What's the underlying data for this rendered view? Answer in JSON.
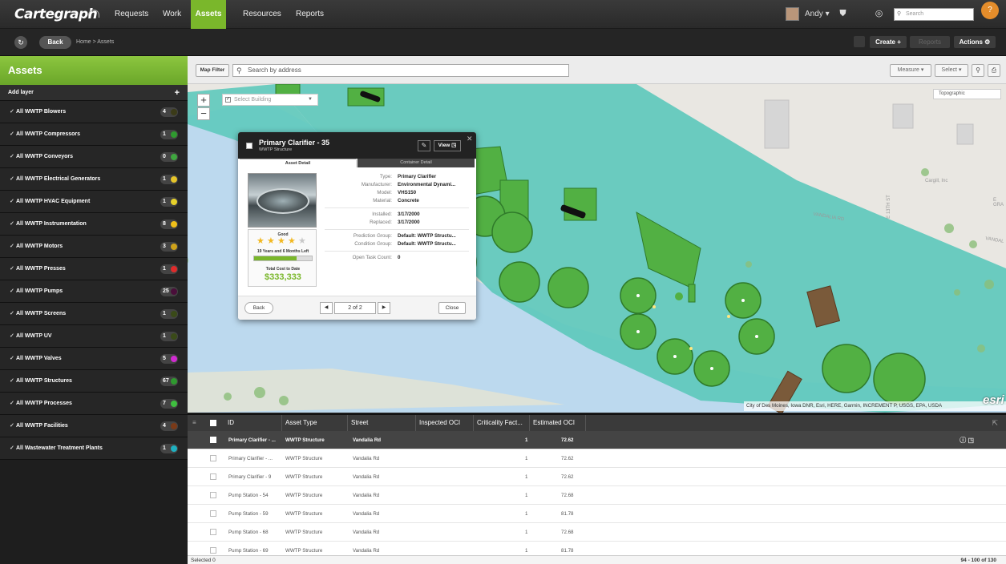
{
  "topnav": {
    "logo": "Cartegraph",
    "links": {
      "requests": "Requests",
      "work": "Work",
      "assets": "Assets",
      "resources": "Resources",
      "reports": "Reports"
    },
    "user": "Andy",
    "search_placeholder": "Search",
    "help_glyph": "?"
  },
  "subbar": {
    "back": "Back",
    "breadcrumb": "Home  >  Assets",
    "create": "Create +",
    "reports": "Reports",
    "actions": "Actions ⚙"
  },
  "sidebar": {
    "title": "Assets",
    "add_layer": "Add layer",
    "layers": [
      {
        "label": "All WWTP Blowers",
        "count": "4",
        "color": "#3b3b18"
      },
      {
        "label": "All WWTP Compressors",
        "count": "1",
        "color": "#2f9a2f"
      },
      {
        "label": "All WWTP Conveyors",
        "count": "0",
        "color": "#3fa63f"
      },
      {
        "label": "All WWTP Electrical Generators",
        "count": "1",
        "color": "#e6c52a"
      },
      {
        "label": "All WWTP HVAC Equipment",
        "count": "1",
        "color": "#e6d12a"
      },
      {
        "label": "All WWTP Instrumentation",
        "count": "8",
        "color": "#f0c019"
      },
      {
        "label": "All WWTP Motors",
        "count": "3",
        "color": "#cfa21a"
      },
      {
        "label": "All WWTP Presses",
        "count": "1",
        "color": "#e02b2b"
      },
      {
        "label": "All WWTP Pumps",
        "count": "25",
        "color": "#4a0e3a"
      },
      {
        "label": "All WWTP Screens",
        "count": "1",
        "color": "#3a4a18"
      },
      {
        "label": "All WWTP UV",
        "count": "1",
        "color": "#3a4a18"
      },
      {
        "label": "All WWTP Valves",
        "count": "5",
        "color": "#d02bd0"
      },
      {
        "label": "All WWTP Structures",
        "count": "67",
        "color": "#2f9a2f"
      },
      {
        "label": "All WWTP Processes",
        "count": "7",
        "color": "#3fbf3f"
      },
      {
        "label": "All WWTP Facilities",
        "count": "4",
        "color": "#7a3a18"
      },
      {
        "label": "All Wastewater Treatment Plants",
        "count": "1",
        "color": "#1fb0c0"
      }
    ]
  },
  "mapbar": {
    "map_filter": "Map Filter",
    "search_placeholder": "Search by address",
    "measure": "Measure",
    "select": "Select"
  },
  "map": {
    "building_select": "Select Building",
    "basemap": "Topographic",
    "attribution": "City of Des Moines, Iowa DNR, Esri, HERE, Garmin, INCREMENT P, USGS, EPA, USDA",
    "esri": "esri",
    "streets": {
      "vandalia": "VANDALIA RD",
      "e13": "E 13TH ST",
      "cargill": "Cargill, Inc",
      "egrand": "E GRA",
      "vandal2": "VANDAL"
    }
  },
  "popup": {
    "title": "Primary Clarifier - 35",
    "subtitle": "WWTP Structure",
    "view": "View",
    "tab_asset": "Asset Detail",
    "tab_container": "Container Detail",
    "condition": "Good",
    "stars": 4,
    "stars_max": 5,
    "life_left": "19 Years and 6 Months Left",
    "life_fraction": 0.74,
    "cost_label": "Total Cost to Date",
    "cost": "$333,333",
    "fields": {
      "type_l": "Type:",
      "type_v": "Primary Clarifier",
      "manufacturer_l": "Manufacturer:",
      "manufacturer_v": "Environmental Dynami...",
      "model_l": "Model:",
      "model_v": "VHS150",
      "material_l": "Material:",
      "material_v": "Concrete",
      "installed_l": "Installed:",
      "installed_v": "3/17/2000",
      "replaced_l": "Replaced:",
      "replaced_v": "3/17/2000",
      "pred_l": "Prediction Group:",
      "pred_v": "Default: WWTP Structu...",
      "cond_l": "Condition Group:",
      "cond_v": "Default: WWTP Structu...",
      "task_l": "Open Task Count:",
      "task_v": "0"
    },
    "back": "Back",
    "page": "2 of 2",
    "close": "Close"
  },
  "grid": {
    "columns": {
      "id": "ID",
      "type": "Asset Type",
      "street": "Street",
      "inspected": "Inspected OCI",
      "criticality": "Criticality Fact...",
      "estimated": "Estimated OCI"
    },
    "rows": [
      {
        "id": "Primary Clarifier - ...",
        "type": "WWTP Structure",
        "street": "Vandalia Rd",
        "crit": "1",
        "oci": "72.62"
      },
      {
        "id": "Primary Clarifier - ...",
        "type": "WWTP Structure",
        "street": "Vandalia Rd",
        "crit": "1",
        "oci": "72.62"
      },
      {
        "id": "Primary Clarifier - 9",
        "type": "WWTP Structure",
        "street": "Vandalia Rd",
        "crit": "1",
        "oci": "72.62"
      },
      {
        "id": "Pump Station - 54",
        "type": "WWTP Structure",
        "street": "Vandalia Rd",
        "crit": "1",
        "oci": "72.68"
      },
      {
        "id": "Pump Station - 59",
        "type": "WWTP Structure",
        "street": "Vandalia Rd",
        "crit": "1",
        "oci": "81.78"
      },
      {
        "id": "Pump Station - 68",
        "type": "WWTP Structure",
        "street": "Vandalia Rd",
        "crit": "1",
        "oci": "72.68"
      },
      {
        "id": "Pump Station - 69",
        "type": "WWTP Structure",
        "street": "Vandalia Rd",
        "crit": "1",
        "oci": "81.78"
      }
    ],
    "selected_label": "Selected 0",
    "range": "94 - 100 of 130"
  },
  "colors": {
    "accent": "#7ab72b",
    "water": "#bcd9ee",
    "plant": "#5ec9bc",
    "structure": "#52b043"
  }
}
